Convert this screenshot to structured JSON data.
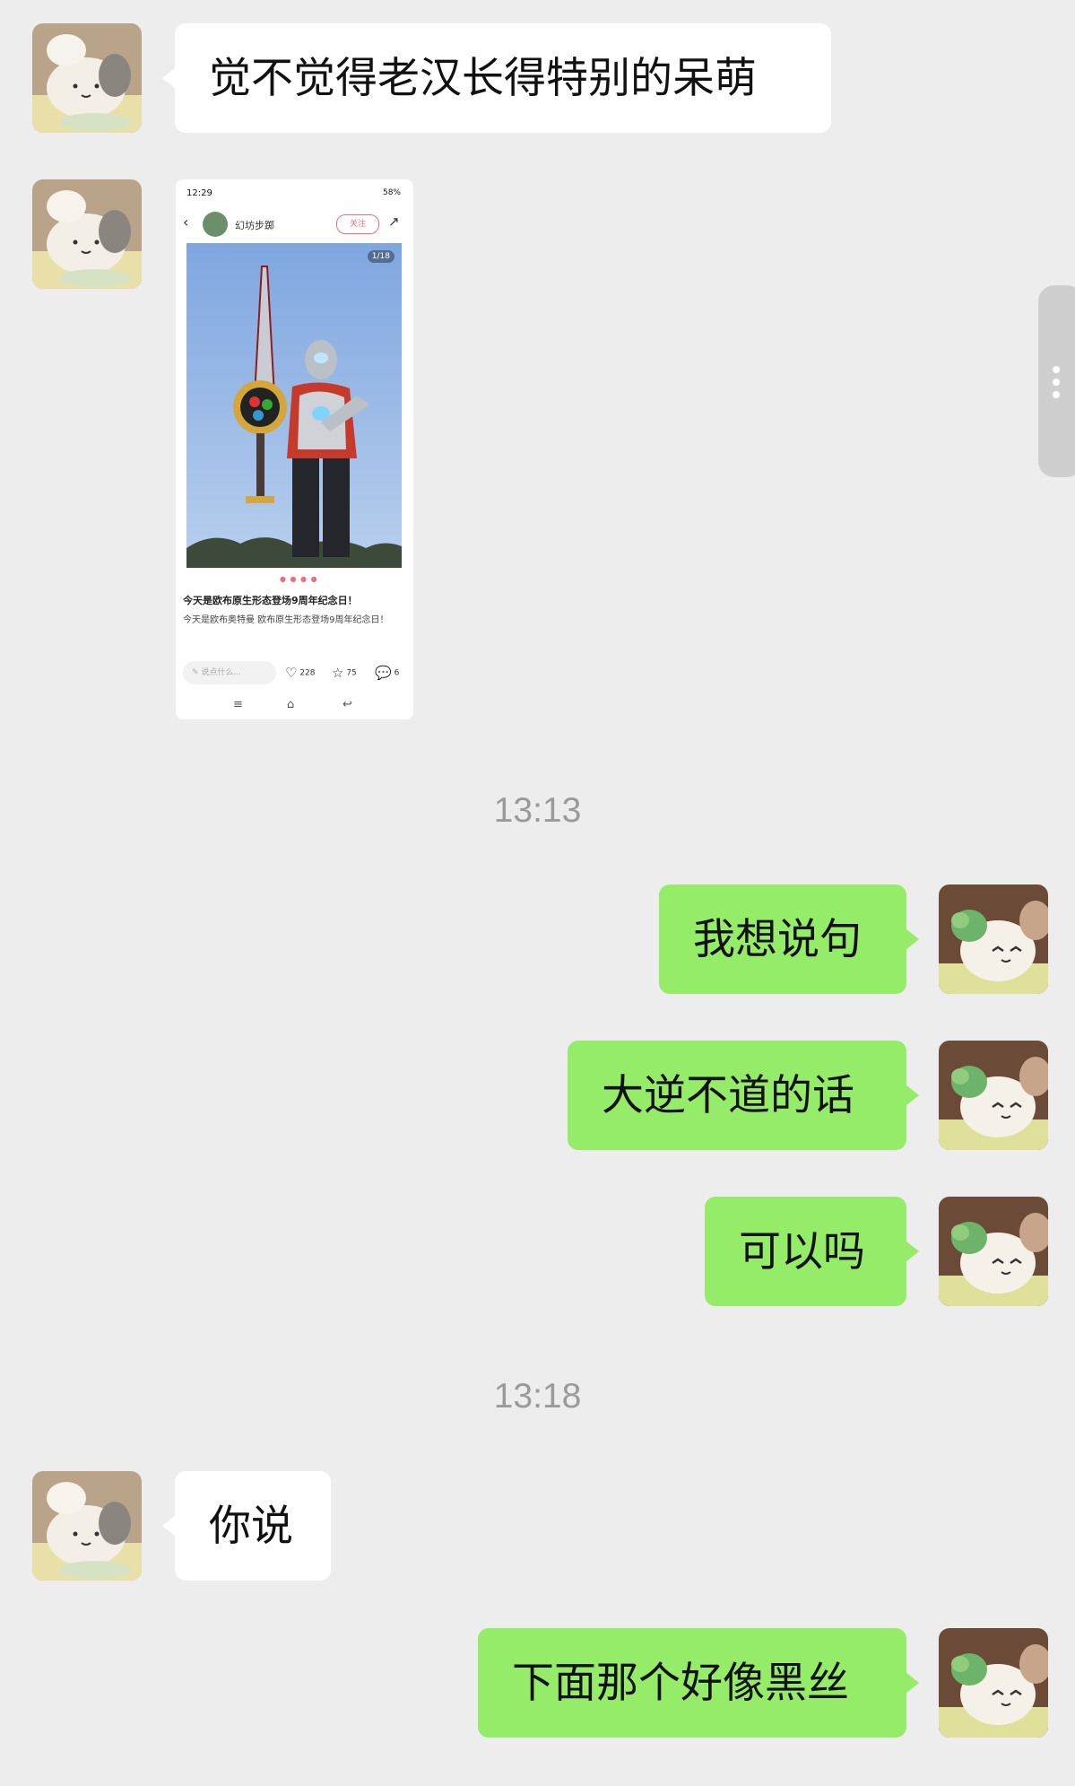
{
  "messages": {
    "m1": "觉不觉得老汉长得特别的呆萌",
    "m3": "我想说句",
    "m4": "大逆不道的话",
    "m5": "可以吗",
    "m6": "你说",
    "m7": "下面那个好像黑丝"
  },
  "timestamps": [
    "13:13",
    "13:18"
  ],
  "shared_image": {
    "status_time": "12:29",
    "status_battery": "58%",
    "username": "幻坊步踯",
    "follow_label": "关注",
    "pager": "1/18",
    "post_title": "今天是欧布原生形态登场9周年纪念日！",
    "post_body": "今天是欧布奥特曼 欧布原生形态登场9周年纪念日！",
    "comment_placeholder": "说点什么...",
    "likes": "228",
    "stars": "75",
    "comments": "6"
  },
  "colors": {
    "background": "#ededed",
    "incoming_bubble": "#ffffff",
    "outgoing_bubble": "#95ec69",
    "timestamp": "#9a9a9a"
  },
  "icons": {
    "back": "chevron-left-icon",
    "share": "share-icon",
    "like": "heart-icon",
    "star": "star-icon",
    "comment": "comment-icon",
    "edit": "pencil-icon",
    "menu": "menu-icon",
    "home": "home-icon",
    "return": "return-icon",
    "handle": "more-vertical-icon"
  }
}
